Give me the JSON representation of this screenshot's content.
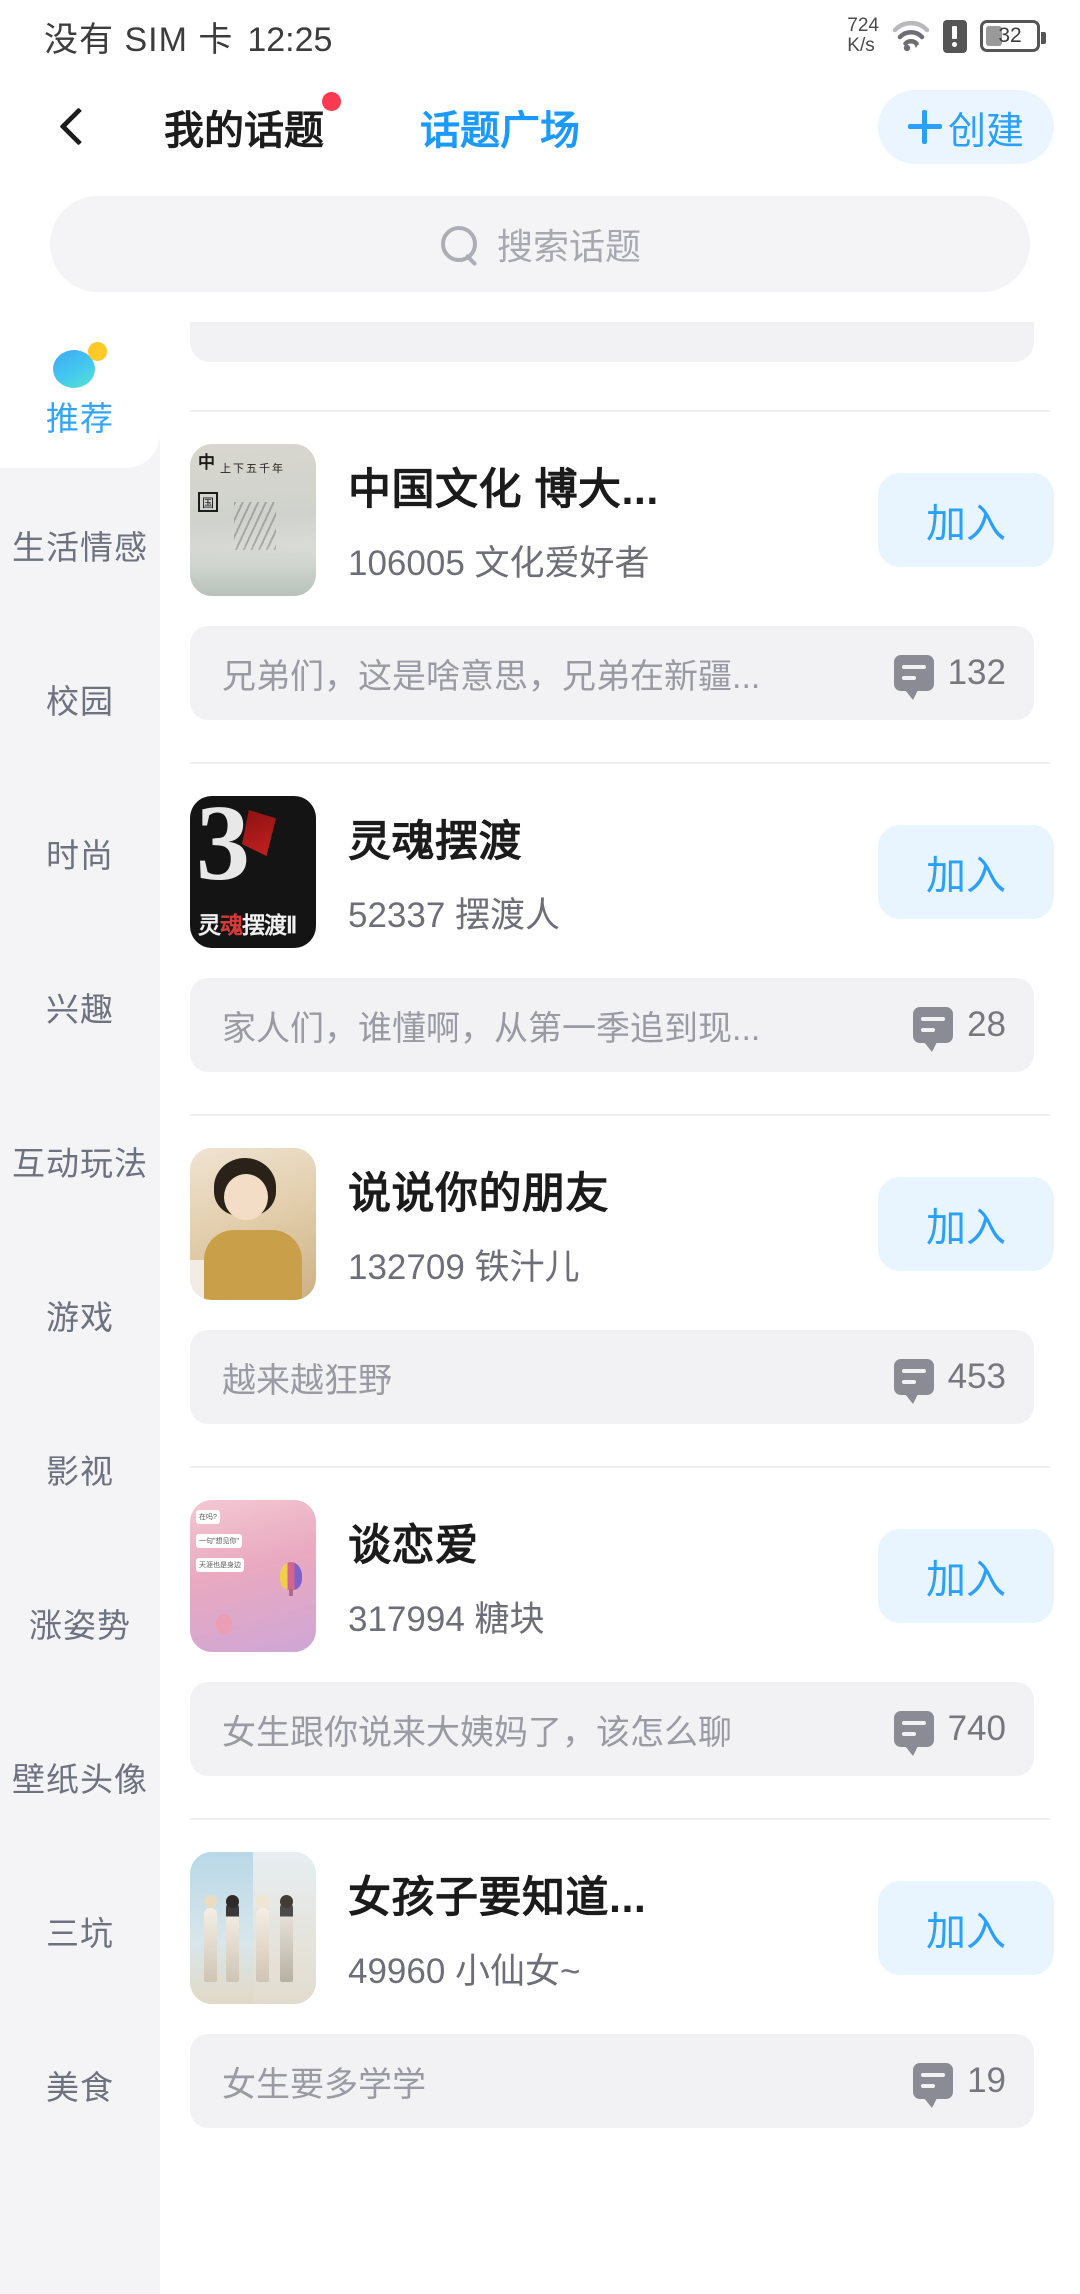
{
  "status_bar": {
    "carrier": "没有 SIM 卡",
    "time": "12:25",
    "net_speed_value": "724",
    "net_speed_unit": "K/s",
    "wifi_icon": "wifi-icon",
    "sim_alert_icon": "sim-alert-icon",
    "battery_percent": "32"
  },
  "header": {
    "back_icon": "back-chevron-icon",
    "tabs": [
      {
        "label": "我的话题",
        "active": false,
        "badge": true
      },
      {
        "label": "话题广场",
        "active": true,
        "badge": false
      }
    ],
    "create_button": {
      "label": "创建",
      "icon": "plus-icon"
    }
  },
  "search": {
    "placeholder": "搜索话题",
    "value": "",
    "icon": "search-icon"
  },
  "sidebar": {
    "items": [
      {
        "label": "推荐",
        "active": true,
        "icon": "recommend-blob-icon"
      },
      {
        "label": "生活情感",
        "active": false
      },
      {
        "label": "校园",
        "active": false
      },
      {
        "label": "时尚",
        "active": false
      },
      {
        "label": "兴趣",
        "active": false
      },
      {
        "label": "互动玩法",
        "active": false
      },
      {
        "label": "游戏",
        "active": false
      },
      {
        "label": "影视",
        "active": false
      },
      {
        "label": "涨姿势",
        "active": false
      },
      {
        "label": "壁纸头像",
        "active": false
      },
      {
        "label": "三坑",
        "active": false
      },
      {
        "label": "美食",
        "active": false
      }
    ]
  },
  "topics": [
    {
      "title": "中国文化 博大...",
      "members": "106005 文化爱好者",
      "join_label": "加入",
      "comment": "兄弟们，这是啥意思，兄弟在新疆...",
      "comment_count": "132",
      "thumb": "china-culture-ink-painting"
    },
    {
      "title": "灵魂摆渡",
      "members": "52337 摆渡人",
      "join_label": "加入",
      "comment": "家人们，谁懂啊，从第一季追到现...",
      "comment_count": "28",
      "thumb": "soul-ferry-poster"
    },
    {
      "title": "说说你的朋友",
      "members": "132709 铁汁儿",
      "join_label": "加入",
      "comment": "越来越狂野",
      "comment_count": "453",
      "thumb": "toddler-photo"
    },
    {
      "title": "谈恋爱",
      "members": "317994 糖块",
      "join_label": "加入",
      "comment": "女生跟你说来大姨妈了，该怎么聊",
      "comment_count": "740",
      "thumb": "pink-chat-balloon"
    },
    {
      "title": "女孩子要知道...",
      "members": "49960 小仙女~",
      "join_label": "加入",
      "comment": "女生要多学学",
      "comment_count": "19",
      "thumb": "girls-beach-illustration"
    }
  ],
  "colors": {
    "accent_blue": "#2aa0fb",
    "accent_blue_soft": "#e8f4fe",
    "badge_red": "#fb3a52",
    "page_bg": "#ffffff",
    "panel_bg": "#f4f4f7",
    "text_primary": "#1b1b1b",
    "text_secondary": "#6e6e78",
    "text_muted": "#9a9aa4"
  }
}
